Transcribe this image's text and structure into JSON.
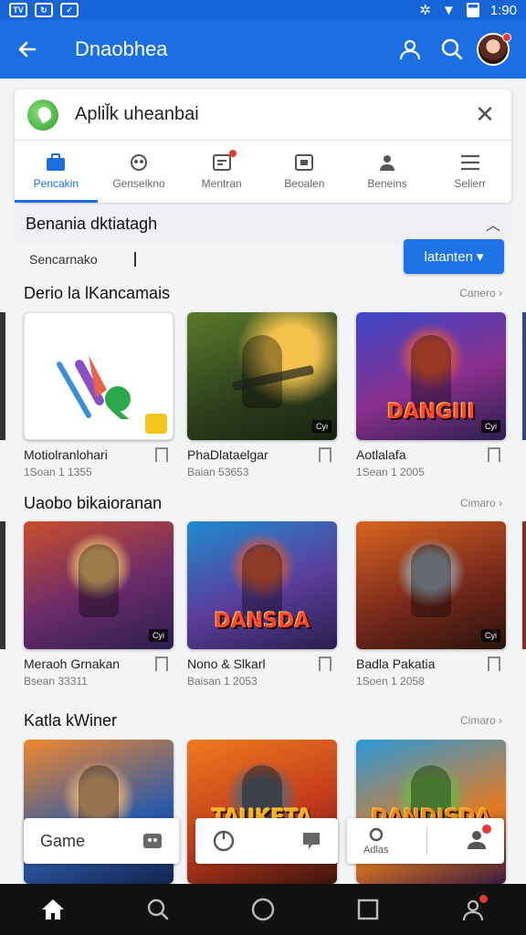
{
  "status_bar": {
    "left_icons": [
      "TV",
      "↻",
      "✓"
    ],
    "time": "1:90"
  },
  "app_bar": {
    "title": "Dnaobhea"
  },
  "search": {
    "value": "Aplil̆k uheanbai"
  },
  "tabs": [
    {
      "label": "Pencakin",
      "icon": "briefcase-icon",
      "active": true
    },
    {
      "label": "Genselkno",
      "icon": "gamepad-icon"
    },
    {
      "label": "Mentran",
      "icon": "receipt-icon",
      "badge": true
    },
    {
      "label": "Beoalen",
      "icon": "camera-icon"
    },
    {
      "label": "Beneins",
      "icon": "person-icon"
    },
    {
      "label": "Selierr",
      "icon": "menu-icon"
    }
  ],
  "dropdown": {
    "title": "Benania dktiatagh"
  },
  "filter": {
    "text": "Sencarnako",
    "button_label": "latanten"
  },
  "sections": [
    {
      "title": "Derio la lKancamais",
      "more": "Canero",
      "games": [
        {
          "name": "Motiolranlohari",
          "sub": "1Soan 1 1355",
          "banner": "",
          "tag": ""
        },
        {
          "name": "PhaDlataelgar",
          "sub": "Baian 53653",
          "banner": "",
          "tag": "Cyi"
        },
        {
          "name": "Aotlalafa",
          "sub": "1Sean 1 2005",
          "banner": "DANGIII",
          "tag": "Cyi"
        }
      ]
    },
    {
      "title": "Uaobo bikaioranan",
      "more": "Cimaro",
      "games": [
        {
          "name": "Meraoh Grnakan",
          "sub": "Bsean 33311",
          "banner": "",
          "tag": "Cyi"
        },
        {
          "name": "Nono & Slkarl",
          "sub": "Baisan 1 2053",
          "banner": "DANSDA",
          "tag": ""
        },
        {
          "name": "Badla Pakatia",
          "sub": "1Soen 1 2058",
          "banner": "",
          "tag": "Cyi"
        }
      ]
    },
    {
      "title": "Katla kWiner",
      "more": "Cimaro",
      "games": [
        {
          "name": "",
          "sub": "",
          "banner": "",
          "tag": ""
        },
        {
          "name": "",
          "sub": "",
          "banner": "TAUKETA",
          "tag": ""
        },
        {
          "name": "",
          "sub": "",
          "banner": "DANDISDA",
          "tag": ""
        }
      ]
    }
  ],
  "floating_tabs": {
    "game_label": "Game",
    "adlas_label": "Adlas"
  },
  "nav": [
    "home-icon",
    "search-icon",
    "circle-icon",
    "square-icon",
    "account-icon"
  ],
  "colors": {
    "primary": "#1c6fe3",
    "status_bar": "#1565d8",
    "badge": "#e53935"
  }
}
